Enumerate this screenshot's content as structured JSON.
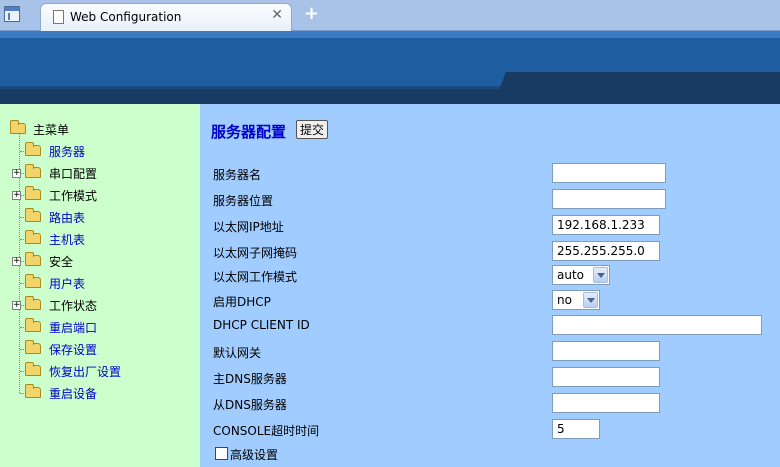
{
  "browser": {
    "tab_title": "Web Configuration",
    "close_glyph": "✕",
    "new_tab_glyph": "+"
  },
  "sidebar": {
    "root_label": "主菜单",
    "items": [
      {
        "label": "服务器",
        "expandable": false,
        "link": true
      },
      {
        "label": "串口配置",
        "expandable": true,
        "link": false
      },
      {
        "label": "工作模式",
        "expandable": true,
        "link": false
      },
      {
        "label": "路由表",
        "expandable": false,
        "link": true
      },
      {
        "label": "主机表",
        "expandable": false,
        "link": true
      },
      {
        "label": "安全",
        "expandable": true,
        "link": false
      },
      {
        "label": "用户表",
        "expandable": false,
        "link": true
      },
      {
        "label": "工作状态",
        "expandable": true,
        "link": false
      },
      {
        "label": "重启端口",
        "expandable": false,
        "link": true
      },
      {
        "label": "保存设置",
        "expandable": false,
        "link": true
      },
      {
        "label": "恢复出厂设置",
        "expandable": false,
        "link": true
      },
      {
        "label": "重启设备",
        "expandable": false,
        "link": true
      }
    ]
  },
  "main": {
    "title": "服务器配置",
    "submit_label": "提交",
    "rows": [
      {
        "label": "服务器名",
        "type": "text",
        "value": ""
      },
      {
        "label": "服务器位置",
        "type": "text",
        "value": ""
      },
      {
        "label": "以太网IP地址",
        "type": "text",
        "value": "192.168.1.233"
      },
      {
        "label": "以太网子网掩码",
        "type": "text",
        "value": "255.255.255.0"
      },
      {
        "label": "以太网工作模式",
        "type": "select",
        "value": "auto"
      },
      {
        "label": "启用DHCP",
        "type": "select",
        "value": "no"
      },
      {
        "label": "DHCP CLIENT ID",
        "type": "text",
        "value": ""
      },
      {
        "label": "默认网关",
        "type": "text",
        "value": ""
      },
      {
        "label": "主DNS服务器",
        "type": "text",
        "value": ""
      },
      {
        "label": "从DNS服务器",
        "type": "text",
        "value": ""
      },
      {
        "label": "CONSOLE超时时间",
        "type": "text",
        "value": "5"
      }
    ],
    "advanced_label": "高级设置",
    "advanced_checked": false
  }
}
